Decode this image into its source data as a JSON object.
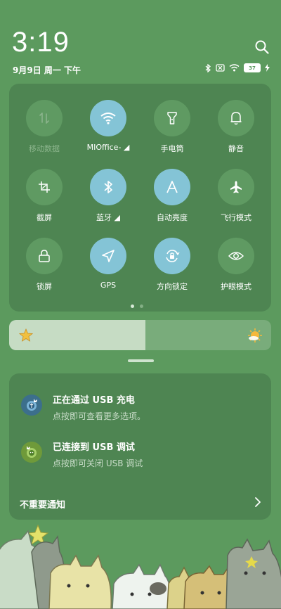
{
  "status_bar": {
    "clock": "3:19",
    "date": "9月9日 周一 下午",
    "battery": "37"
  },
  "icons": {
    "search": "search-icon",
    "bluetooth": "bluetooth-icon",
    "sim": "no-sim-icon",
    "wifi": "wifi-icon",
    "battery": "battery-icon",
    "charging": "bolt-icon"
  },
  "colors": {
    "background": "#5c9a5e",
    "panel": "#4e8552",
    "tile_off": "#5f9a62",
    "tile_on": "#84c4d6"
  },
  "quick_settings": {
    "tiles": [
      {
        "label": "移动数据",
        "active": false,
        "disabled": true,
        "icon": "mobile-data-icon"
      },
      {
        "label": "MIOffice-",
        "active": true,
        "disabled": false,
        "icon": "wifi-icon",
        "has_arrow": true
      },
      {
        "label": "手电筒",
        "active": false,
        "disabled": false,
        "icon": "flashlight-icon"
      },
      {
        "label": "静音",
        "active": false,
        "disabled": false,
        "icon": "bell-icon"
      },
      {
        "label": "截屏",
        "active": false,
        "disabled": false,
        "icon": "screenshot-icon"
      },
      {
        "label": "蓝牙",
        "active": true,
        "disabled": false,
        "icon": "bluetooth-icon",
        "has_arrow": true
      },
      {
        "label": "自动亮度",
        "active": true,
        "disabled": false,
        "icon": "auto-brightness-icon"
      },
      {
        "label": "飞行模式",
        "active": false,
        "disabled": false,
        "icon": "airplane-icon"
      },
      {
        "label": "锁屏",
        "active": false,
        "disabled": false,
        "icon": "lock-icon"
      },
      {
        "label": "GPS",
        "active": true,
        "disabled": false,
        "icon": "location-arrow-icon"
      },
      {
        "label": "方向锁定",
        "active": true,
        "disabled": false,
        "icon": "rotation-lock-icon"
      },
      {
        "label": "护眼模式",
        "active": false,
        "disabled": false,
        "icon": "eye-icon"
      }
    ],
    "page_count": 2,
    "current_page": 1
  },
  "brightness": {
    "level": 0.52,
    "low_icon": "dim-sun-icon",
    "high_icon": "bright-sun-icon"
  },
  "notifications": {
    "items": [
      {
        "title": "正在通过 USB 充电",
        "subtitle": "点按即可查看更多选项。",
        "icon": "usb-charging-icon"
      },
      {
        "title": "已连接到 USB 调试",
        "subtitle": "点按即可关闭 USB 调试",
        "icon": "android-debug-icon"
      }
    ],
    "minor_label": "不重要通知"
  }
}
